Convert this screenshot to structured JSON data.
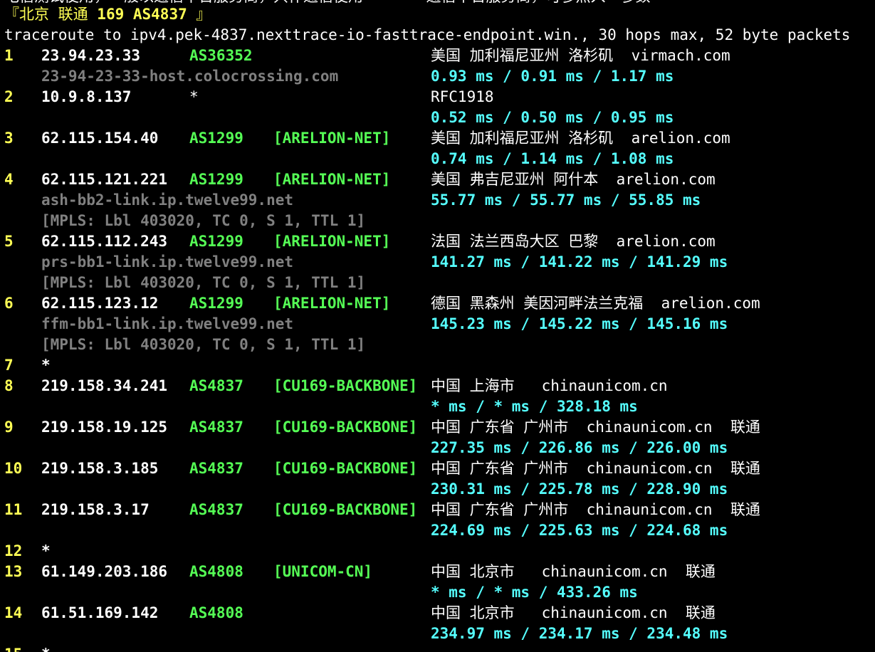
{
  "colors": {
    "background": "#000000",
    "hop_number": "#ffff55",
    "asn": "#55ff55",
    "hostname": "#808080",
    "latency": "#55ffff",
    "text": "#ffffff"
  },
  "top_partial": "电信测试使用，一般以通信平台服务商，只作通信使用       通信平台服务商，可参照入一参数",
  "header": {
    "target_open": "『北京 联通 ",
    "target_bold": "169 AS4837",
    "target_close": " 』",
    "command": "traceroute to ipv4.pek-4837.nexttrace-io-fasttrace-endpoint.win., 30 hops max, 52 byte packets"
  },
  "hops": [
    {
      "n": "1",
      "ip": "23.94.23.33",
      "asn": "AS36352",
      "net": "",
      "geo": "美国 加利福尼亚州 洛杉矶  virmach.com",
      "host": "23-94-23-33-host.colocrossing.com",
      "lat": "0.93 ms / 0.91 ms / 1.17 ms",
      "mpls": ""
    },
    {
      "n": "2",
      "ip": "10.9.8.137",
      "asn": "*",
      "net": "",
      "geo": "RFC1918",
      "host": "",
      "lat": "0.52 ms / 0.50 ms / 0.95 ms",
      "mpls": ""
    },
    {
      "n": "3",
      "ip": "62.115.154.40",
      "asn": "AS1299",
      "net": "[ARELION-NET]",
      "geo": "美国 加利福尼亚州 洛杉矶  arelion.com",
      "host": "",
      "lat": "0.74 ms / 1.14 ms / 1.08 ms",
      "mpls": ""
    },
    {
      "n": "4",
      "ip": "62.115.121.221",
      "asn": "AS1299",
      "net": "[ARELION-NET]",
      "geo": "美国 弗吉尼亚州 阿什本  arelion.com",
      "host": "ash-bb2-link.ip.twelve99.net",
      "lat": "55.77 ms / 55.77 ms / 55.85 ms",
      "mpls": "[MPLS: Lbl 403020, TC 0, S 1, TTL 1]"
    },
    {
      "n": "5",
      "ip": "62.115.112.243",
      "asn": "AS1299",
      "net": "[ARELION-NET]",
      "geo": "法国 法兰西岛大区 巴黎  arelion.com",
      "host": "prs-bb1-link.ip.twelve99.net",
      "lat": "141.27 ms / 141.22 ms / 141.29 ms",
      "mpls": "[MPLS: Lbl 403020, TC 0, S 1, TTL 1]"
    },
    {
      "n": "6",
      "ip": "62.115.123.12",
      "asn": "AS1299",
      "net": "[ARELION-NET]",
      "geo": "德国 黑森州 美因河畔法兰克福  arelion.com",
      "host": "ffm-bb1-link.ip.twelve99.net",
      "lat": "145.23 ms / 145.22 ms / 145.16 ms",
      "mpls": "[MPLS: Lbl 403020, TC 0, S 1, TTL 1]"
    },
    {
      "n": "7",
      "ip": "*",
      "asn": "",
      "net": "",
      "geo": "",
      "host": "",
      "lat": "",
      "mpls": ""
    },
    {
      "n": "8",
      "ip": "219.158.34.241",
      "asn": "AS4837",
      "net": "[CU169-BACKBONE]",
      "geo": "中国 上海市   chinaunicom.cn",
      "host": "",
      "lat": "* ms / * ms / 328.18 ms",
      "mpls": ""
    },
    {
      "n": "9",
      "ip": "219.158.19.125",
      "asn": "AS4837",
      "net": "[CU169-BACKBONE]",
      "geo": "中国 广东省 广州市  chinaunicom.cn  联通",
      "host": "",
      "lat": "227.35 ms / 226.86 ms / 226.00 ms",
      "mpls": ""
    },
    {
      "n": "10",
      "ip": "219.158.3.185",
      "asn": "AS4837",
      "net": "[CU169-BACKBONE]",
      "geo": "中国 广东省 广州市  chinaunicom.cn  联通",
      "host": "",
      "lat": "230.31 ms / 225.78 ms / 228.90 ms",
      "mpls": ""
    },
    {
      "n": "11",
      "ip": "219.158.3.17",
      "asn": "AS4837",
      "net": "[CU169-BACKBONE]",
      "geo": "中国 广东省 广州市  chinaunicom.cn  联通",
      "host": "",
      "lat": "224.69 ms / 225.63 ms / 224.68 ms",
      "mpls": ""
    },
    {
      "n": "12",
      "ip": "*",
      "asn": "",
      "net": "",
      "geo": "",
      "host": "",
      "lat": "",
      "mpls": ""
    },
    {
      "n": "13",
      "ip": "61.149.203.186",
      "asn": "AS4808",
      "net": "[UNICOM-CN]",
      "geo": "中国 北京市   chinaunicom.cn  联通",
      "host": "",
      "lat": "* ms / * ms / 433.26 ms",
      "mpls": ""
    },
    {
      "n": "14",
      "ip": "61.51.169.142",
      "asn": "AS4808",
      "net": "",
      "geo": "中国 北京市   chinaunicom.cn  联通",
      "host": "",
      "lat": "234.97 ms / 234.17 ms / 234.48 ms",
      "mpls": ""
    },
    {
      "n": "15",
      "ip": "*",
      "asn": "",
      "net": "",
      "geo": "",
      "host": "",
      "lat": "",
      "mpls": ""
    }
  ]
}
